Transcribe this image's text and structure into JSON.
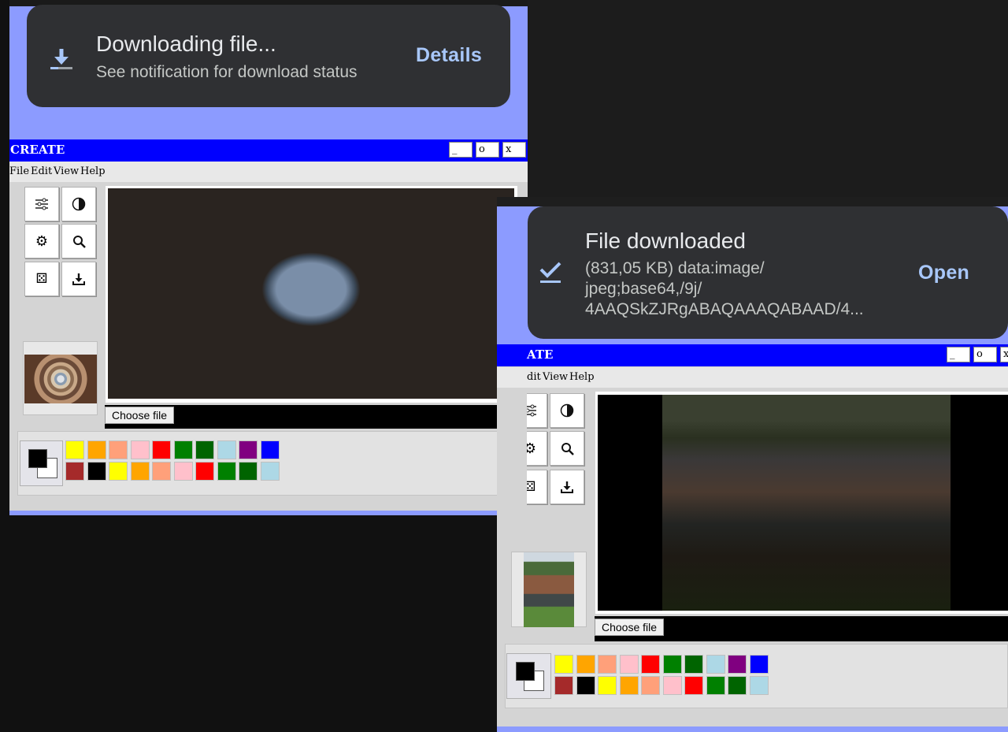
{
  "left": {
    "toast": {
      "title": "Downloading file...",
      "subtitle": "See notification for download status",
      "action": "Details",
      "icon": "download-icon"
    },
    "window": {
      "title": "CREATE",
      "buttons": {
        "minimize": "_",
        "maximize": "o",
        "close": "x"
      },
      "menu": [
        "File",
        "Edit",
        "View",
        "Help"
      ],
      "choose_file": "Choose file"
    }
  },
  "right": {
    "toast": {
      "title": "File downloaded",
      "detail_lines": [
        "(831,05 KB) data:image/",
        "jpeg;base64,/9j/",
        "4AAQSkZJRgABAQAAAQABAAD/4..."
      ],
      "action": "Open",
      "icon": "check-download-icon"
    },
    "window": {
      "title": "ATE",
      "buttons": {
        "minimize": "_",
        "maximize": "o",
        "close": "x"
      },
      "menu": [
        "dit",
        "View",
        "Help"
      ],
      "choose_file": "Choose file"
    }
  },
  "palette": {
    "row1": [
      "#ffff00",
      "#ffa500",
      "#ffa07a",
      "#ffc0cb",
      "#ff0000",
      "#008000",
      "#006400",
      "#add8e6",
      "#800080",
      "#0000ff"
    ],
    "row2": [
      "#a52a2a",
      "#000000",
      "#ffff00",
      "#ffa500",
      "#ffa07a",
      "#ffc0cb",
      "#ff0000",
      "#008000",
      "#006400",
      "#add8e6"
    ],
    "foreground": "#000000",
    "background": "#ffffff"
  },
  "tools": [
    "sliders-icon",
    "contrast-icon",
    "gear-icon",
    "search-icon",
    "dice-icon",
    "download-tray-icon"
  ]
}
